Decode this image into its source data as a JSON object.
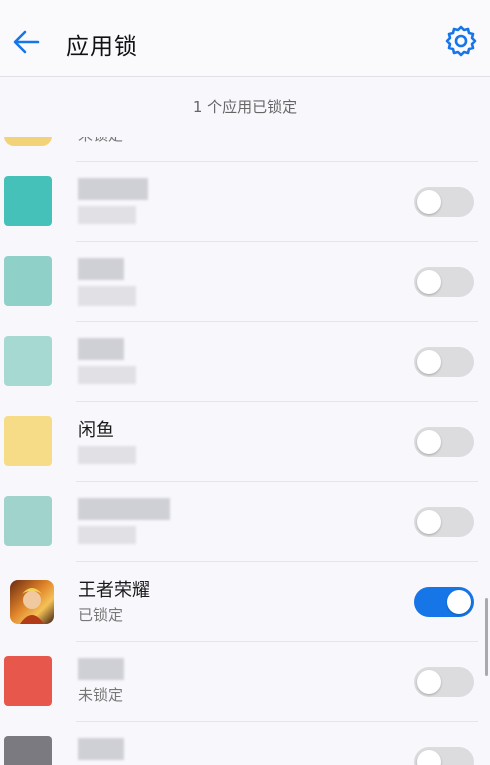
{
  "header": {
    "title": "应用锁",
    "back_icon": "back-arrow-icon",
    "settings_icon": "gear-icon"
  },
  "summary": {
    "text": "1 个应用已锁定"
  },
  "colors": {
    "accent": "#1676e8",
    "toggle_off": "#dcdcdf"
  },
  "apps": [
    {
      "name": "",
      "status": "未锁定",
      "locked": false
    },
    {
      "name": "",
      "status": "",
      "locked": false
    },
    {
      "name": "",
      "status": "",
      "locked": false
    },
    {
      "name": "",
      "status": "",
      "locked": false
    },
    {
      "name": "闲鱼",
      "status": "",
      "locked": false
    },
    {
      "name": "",
      "status": "",
      "locked": false
    },
    {
      "name": "王者荣耀",
      "status": "已锁定",
      "locked": true
    },
    {
      "name": "",
      "status": "未锁定",
      "locked": false
    },
    {
      "name": "",
      "status": "",
      "locked": false
    }
  ]
}
